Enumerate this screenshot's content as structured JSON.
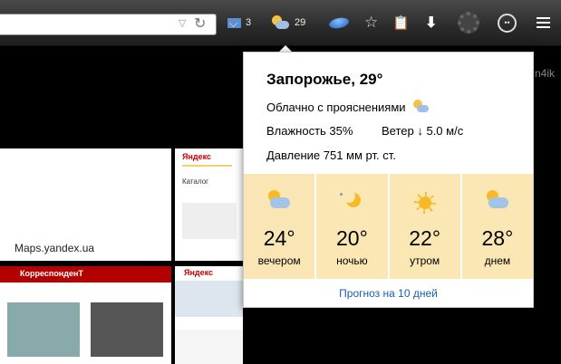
{
  "toolbar": {
    "mail_count": "3",
    "weather_temp": "29",
    "url_dropdown_glyph": "▽",
    "url_reload_glyph": "↻"
  },
  "background": {
    "corner_text": "n4ik",
    "tile_maps_label": "Maps.yandex.ua",
    "tile_yandex_logo": "Яндекс",
    "tile_yandex_catalog": "Каталог",
    "tile_news_logo": "КорреспонденТ",
    "tile_yandex2_logo": "Яндекс"
  },
  "weather": {
    "city_temp": "Запорожье, 29°",
    "condition": "Облачно с прояснениями",
    "humidity": "Влажность 35%",
    "wind": "Ветер ↓ 5.0 м/с",
    "pressure": "Давление 751 мм рт. ст.",
    "forecast": [
      {
        "temp": "24°",
        "label": "вечером",
        "icon": "cloud-sun-icon"
      },
      {
        "temp": "20°",
        "label": "ночью",
        "icon": "moon-icon"
      },
      {
        "temp": "22°",
        "label": "утром",
        "icon": "sun-icon"
      },
      {
        "temp": "28°",
        "label": "днем",
        "icon": "cloud-sun-icon"
      }
    ],
    "link": "Прогноз на 10 дней"
  }
}
